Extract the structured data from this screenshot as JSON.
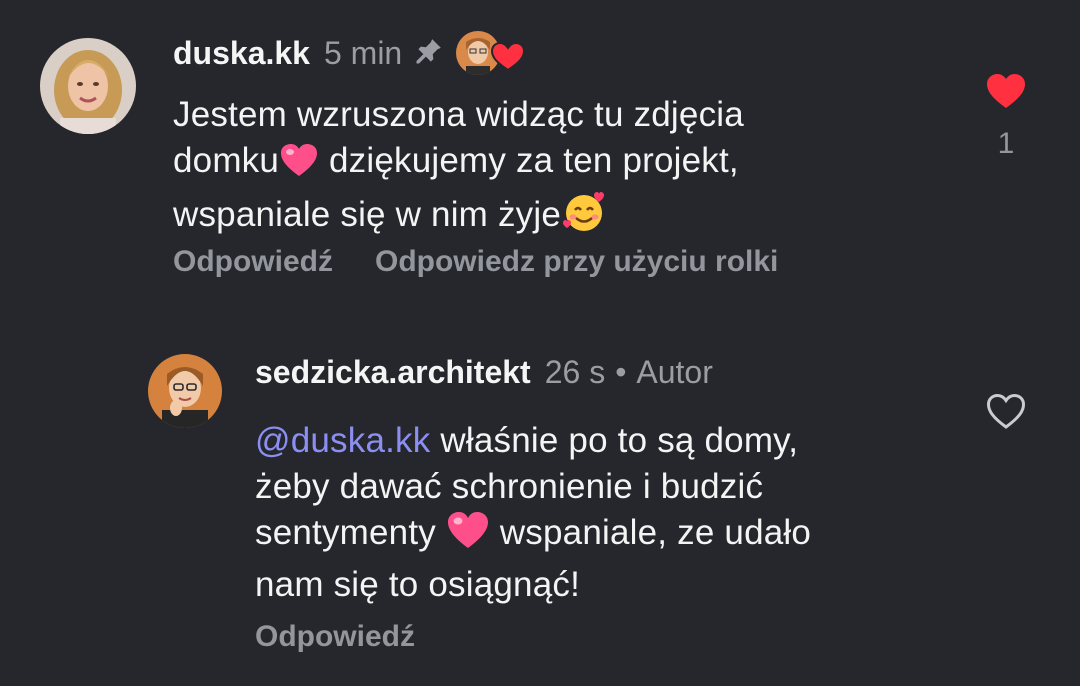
{
  "comments": [
    {
      "username": "duska.kk",
      "time": "5 min",
      "text_line1": "Jestem wzruszona widząc tu zdjęcia",
      "text_line2a": "domku",
      "text_line2b": " dziękujemy za ten projekt,",
      "text_line3": "wspaniale się w nim żyje",
      "reply_label": "Odpowiedź",
      "reel_reply_label": "Odpowiedz przy użyciu rolki",
      "like_count": "1",
      "liked": true,
      "pinned": true,
      "liked_by_author": true
    },
    {
      "username": "sedzicka.architekt",
      "time": "26 s",
      "dot": "•",
      "author_badge": "Autor",
      "mention": "@duska.kk",
      "text_line1": " właśnie po to są domy,",
      "text_line2": "żeby dawać schronienie i budzić",
      "text_line3a": "sentymenty ",
      "text_line3b": " wspaniale, ze udało",
      "text_line4": "nam się to osiągnąć!",
      "reply_label": "Odpowiedź",
      "liked": false
    }
  ],
  "colors": {
    "background": "#25272c",
    "like_red": "#ff3040",
    "mention": "#8c8ff2",
    "muted": "#93969c"
  }
}
